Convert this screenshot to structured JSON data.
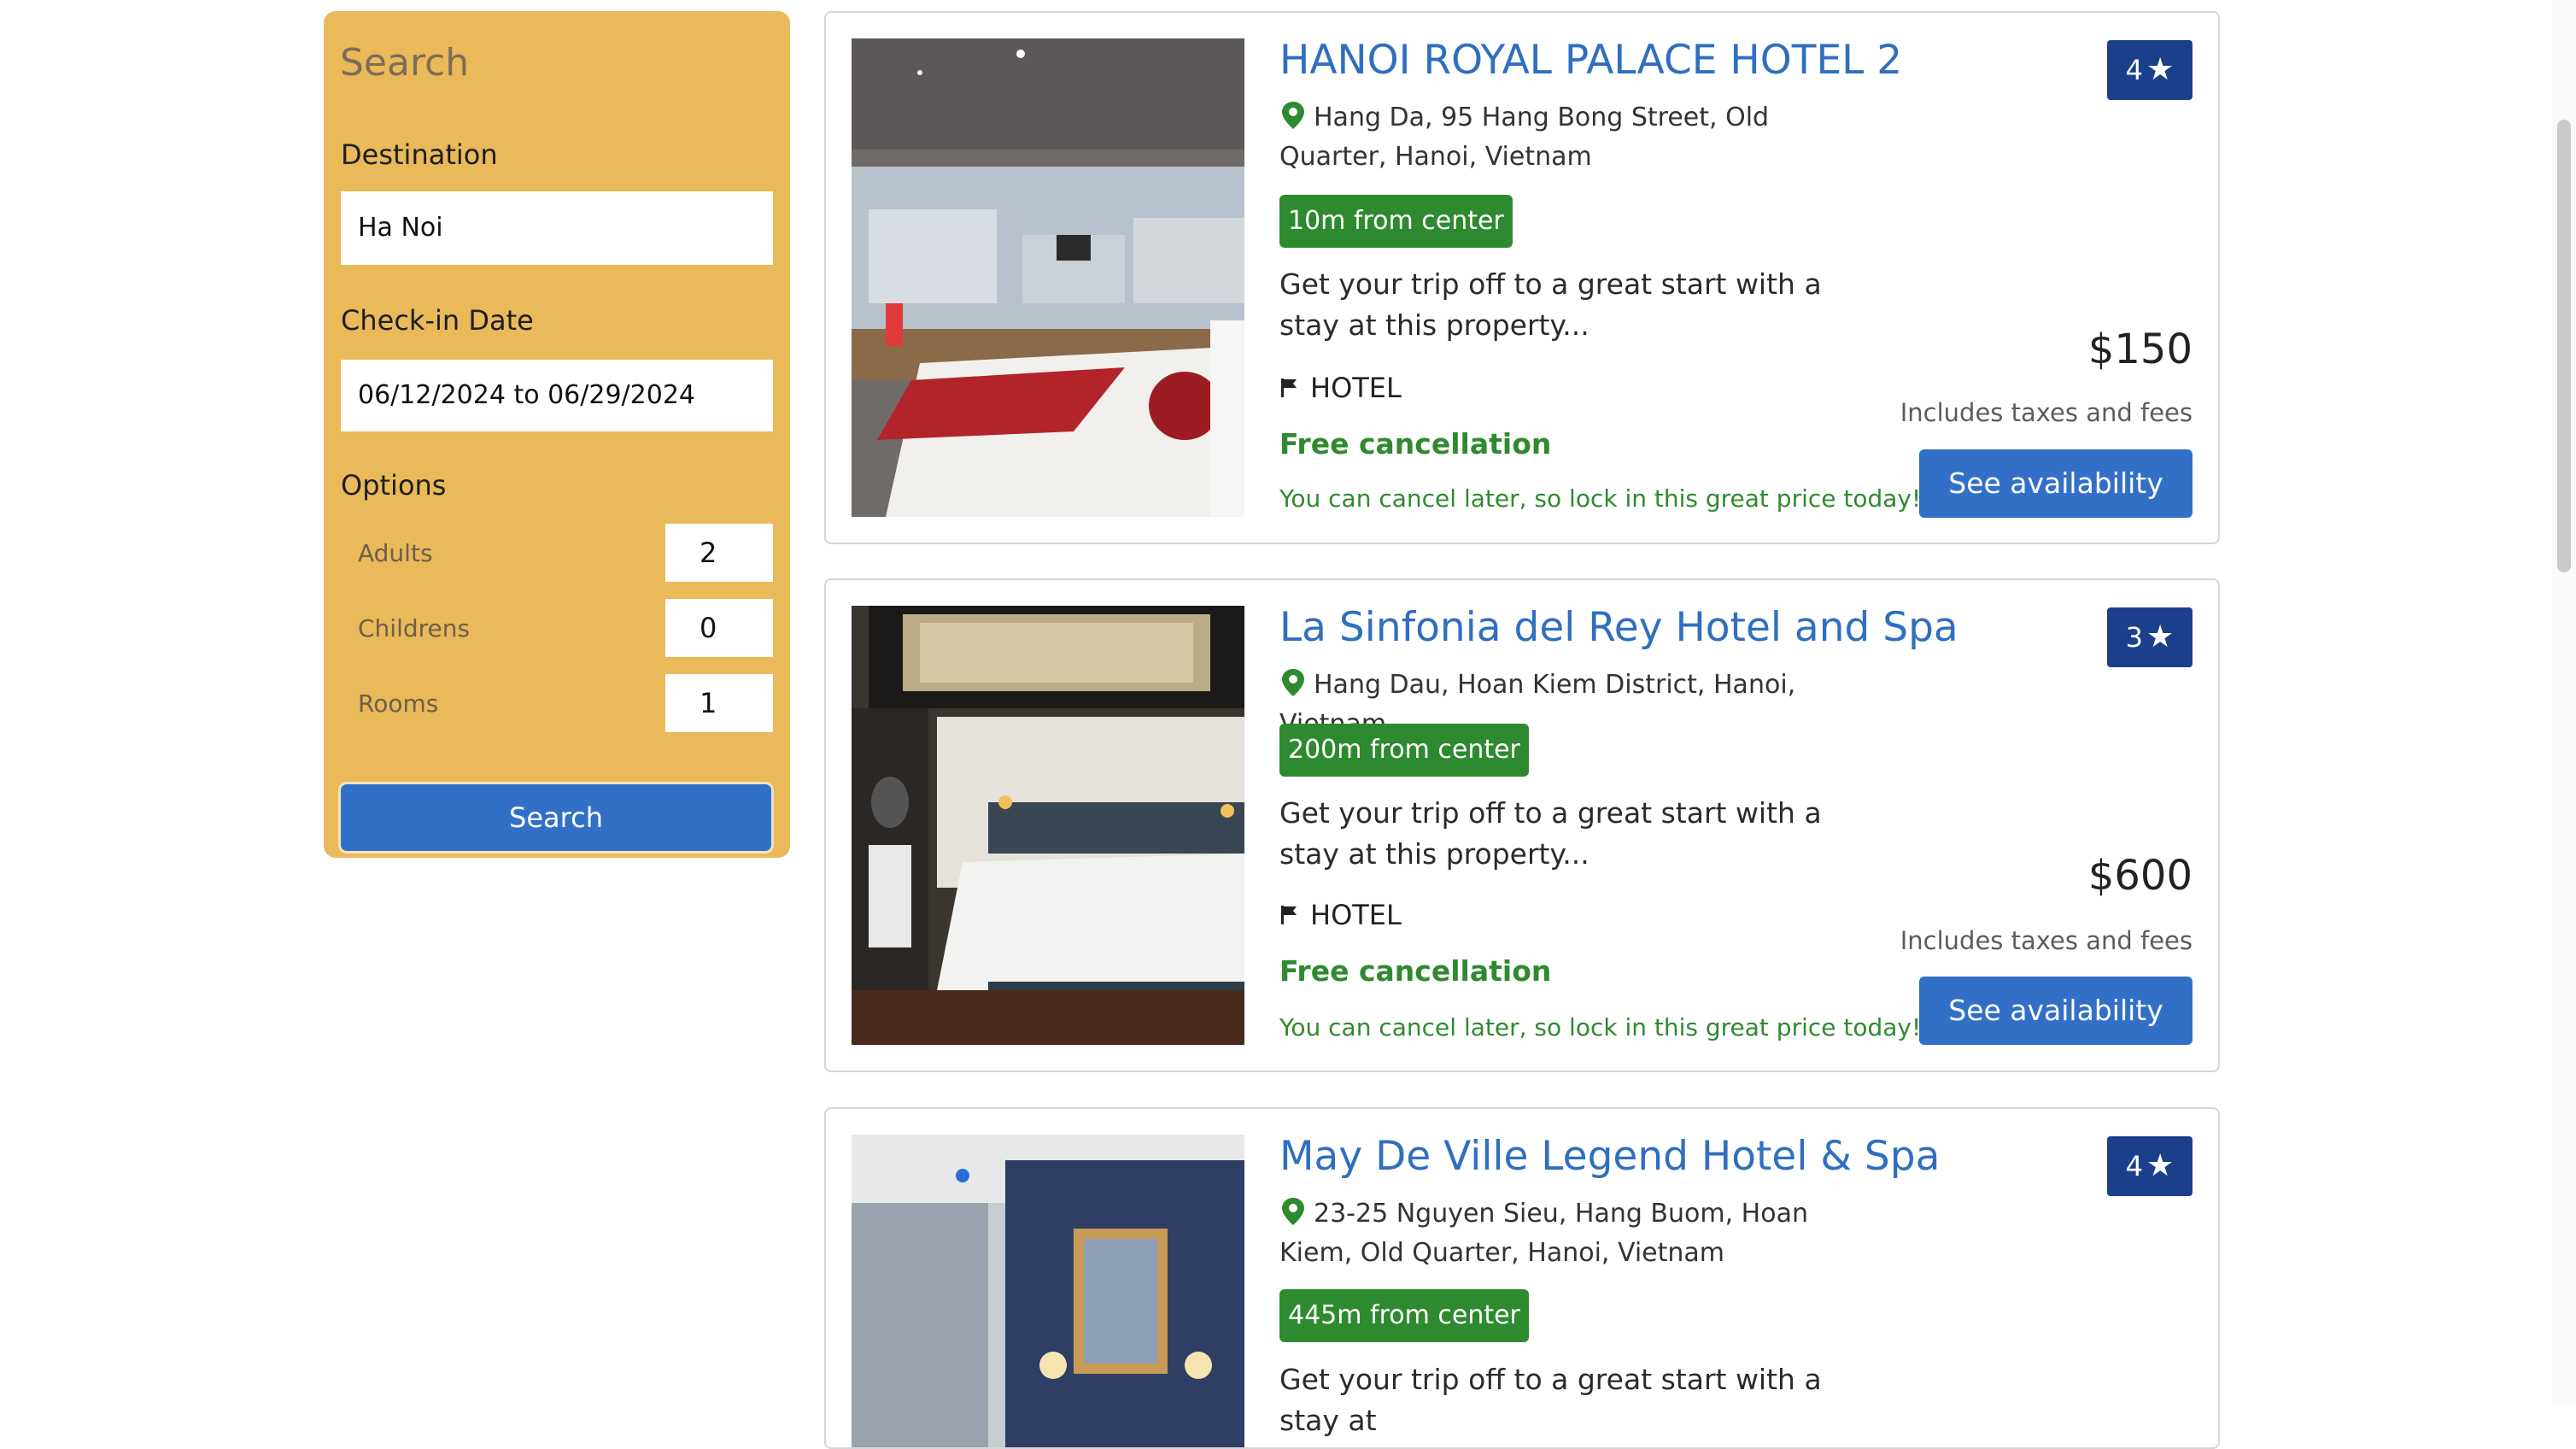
{
  "search": {
    "title": "Search",
    "destination_label": "Destination",
    "destination_value": "Ha Noi",
    "checkin_label": "Check-in Date",
    "checkin_value": "06/12/2024 to 06/29/2024",
    "options_label": "Options",
    "options": {
      "adults_label": "Adults",
      "adults_value": "2",
      "children_label": "Childrens",
      "children_value": "0",
      "rooms_label": "Rooms",
      "rooms_value": "1"
    },
    "button_label": "Search"
  },
  "hotels": [
    {
      "name": "HANOI ROYAL PALACE HOTEL 2",
      "address": "Hang Da, 95 Hang Bong Street, Old Quarter, Hanoi, Vietnam",
      "distance": "10m from center",
      "description": "Get your trip off to a great start with a stay at this property...",
      "type": "HOTEL",
      "free_cancellation": "Free cancellation",
      "cancel_note": "You can cancel later, so lock in this great price today!",
      "stars": "4",
      "price": "$150",
      "taxes": "Includes taxes and fees",
      "button_label": "See availability"
    },
    {
      "name": "La Sinfonia del Rey Hotel and Spa",
      "address": "Hang Dau, Hoan Kiem District, Hanoi, Vietnam",
      "distance": "200m from center",
      "description": "Get your trip off to a great start with a stay at this property...",
      "type": "HOTEL",
      "free_cancellation": "Free cancellation",
      "cancel_note": "You can cancel later, so lock in this great price today!",
      "stars": "3",
      "price": "$600",
      "taxes": "Includes taxes and fees",
      "button_label": "See availability"
    },
    {
      "name": "May De Ville Legend Hotel & Spa",
      "address": "23-25 Nguyen Sieu, Hang Buom, Hoan Kiem, Old Quarter, Hanoi, Vietnam",
      "distance": "445m from center",
      "description": "Get your trip off to a great start with a stay at",
      "stars": "4"
    }
  ],
  "icons": {
    "pin": "location-pin-icon",
    "flag": "flag-icon",
    "star": "star-icon"
  },
  "colors": {
    "sidebar_bg": "#e9b95a",
    "primary_button": "#3270c8",
    "hotel_title": "#2f6fc0",
    "distance_badge": "#2e8a2e",
    "star_badge": "#1c3f8c",
    "free_cancellation": "#2f8a2f"
  }
}
